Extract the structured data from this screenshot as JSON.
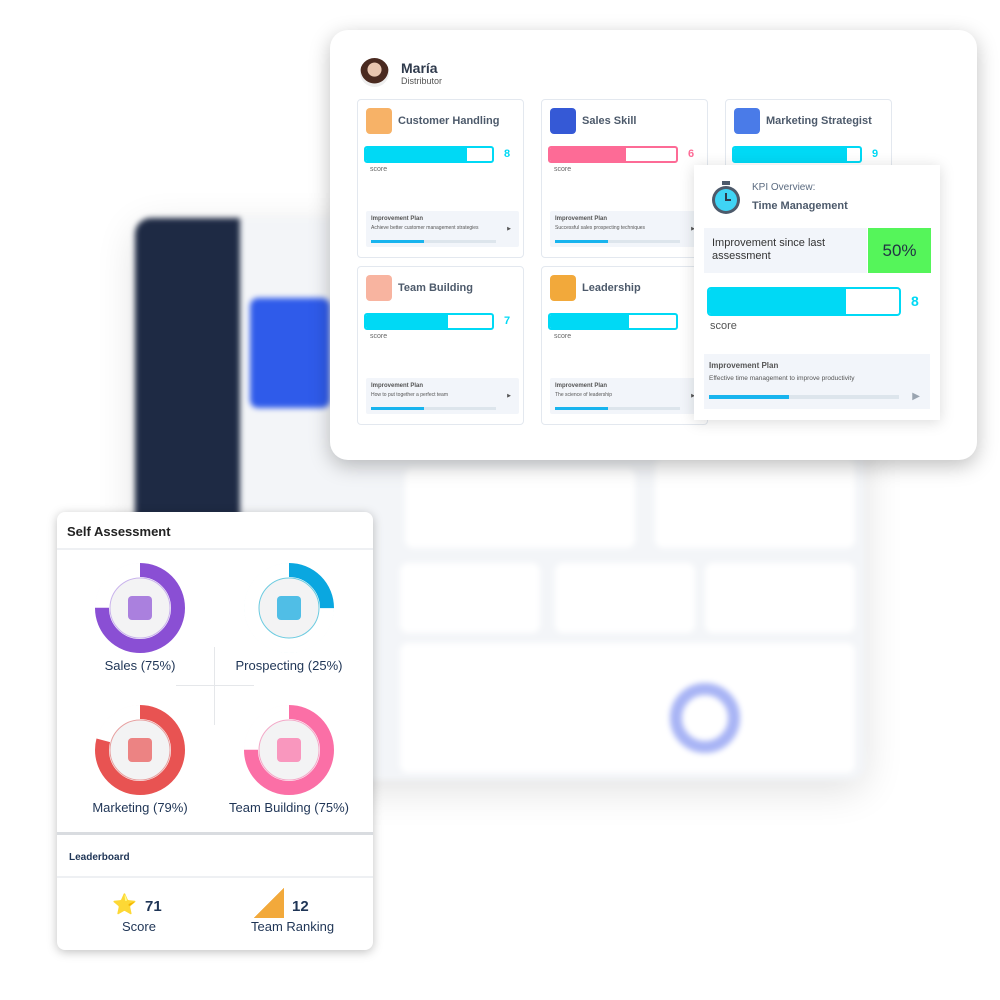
{
  "profile": {
    "name": "María",
    "role": "Distributor"
  },
  "skills": [
    {
      "title": "Customer Handling",
      "score": "8",
      "fill": 0.8,
      "color": "#00d9f5",
      "score_label": "score",
      "plan_title": "Improvement Plan",
      "plan_text": "Achieve better customer management strategies",
      "plan_progress": 0.42
    },
    {
      "title": "Sales Skill",
      "score": "6",
      "fill": 0.6,
      "color": "#fd6b96",
      "score_label": "score",
      "plan_title": "Improvement Plan",
      "plan_text": "Successful sales prospecting techniques",
      "plan_progress": 0.42
    },
    {
      "title": "Marketing Strategist",
      "score": "9",
      "fill": 0.9,
      "color": "#00d9f5"
    },
    {
      "title": "Team Building",
      "score": "7",
      "fill": 0.65,
      "color": "#00d9f5",
      "score_label": "score",
      "plan_title": "Improvement Plan",
      "plan_text": "How to put together a perfect team",
      "plan_progress": 0.42
    },
    {
      "title": "Leadership",
      "fill": 0.63,
      "color": "#00d9f5",
      "score_label": "score",
      "plan_title": "Improvement Plan",
      "plan_text": "The science of leadership",
      "plan_progress": 0.42
    }
  ],
  "kpi": {
    "heading": "KPI Overview:",
    "title": "Time Management",
    "improvement_label": "Improvement since last assessment",
    "improvement_value": "50%",
    "improvement_color": "#55f55a",
    "score": "8",
    "fill": 0.72,
    "score_label": "score",
    "plan_title": "Improvement Plan",
    "plan_text": "Effective time management to improve productivity",
    "plan_progress": 0.42
  },
  "self_assessment": {
    "title": "Self Assessment",
    "items": [
      {
        "label": "Sales (75%)",
        "percent": 75,
        "color": "#8a4fd4",
        "ring": "#c9b3ec"
      },
      {
        "label": "Prospecting (25%)",
        "percent": 25,
        "color": "#0aa7e0",
        "ring": "#6ccbe0"
      },
      {
        "label": "Marketing (79%)",
        "percent": 79,
        "color": "#e85352",
        "ring": "#e7a0a0"
      },
      {
        "label": "Team Building (75%)",
        "percent": 75,
        "color": "#fb6fa6",
        "ring": "#f3a9c8"
      }
    ]
  },
  "leaderboard": {
    "title": "Leaderboard",
    "score_value": "71",
    "score_label": "Score",
    "rank_value": "12",
    "rank_label": "Team Ranking"
  }
}
